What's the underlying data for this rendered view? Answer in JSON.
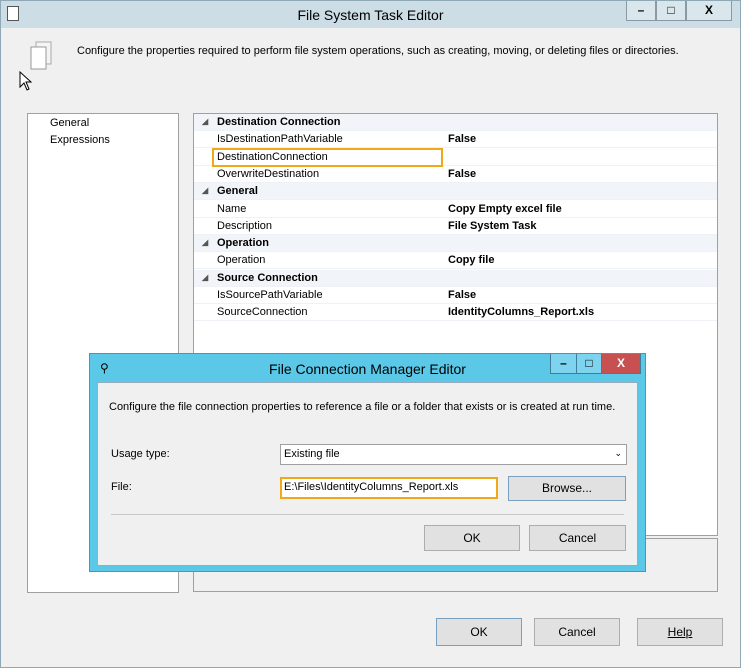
{
  "main": {
    "title": "File System Task Editor",
    "description": "Configure the properties required to perform file system operations, such as creating, moving, or deleting files or directories.",
    "window_buttons": {
      "minimize": "–",
      "maximize": "□",
      "close": "X"
    },
    "nav": [
      "General",
      "Expressions"
    ],
    "groups": [
      {
        "name": "Destination Connection",
        "props": [
          {
            "n": "IsDestinationPathVariable",
            "v": "False"
          },
          {
            "n": "DestinationConnection",
            "v": ""
          },
          {
            "n": "OverwriteDestination",
            "v": "False"
          }
        ]
      },
      {
        "name": "General",
        "props": [
          {
            "n": "Name",
            "v": "Copy Empty excel file"
          },
          {
            "n": "Description",
            "v": "File System Task"
          }
        ]
      },
      {
        "name": "Operation",
        "props": [
          {
            "n": "Operation",
            "v": "Copy file"
          }
        ]
      },
      {
        "name": "Source Connection",
        "props": [
          {
            "n": "IsSourcePathVariable",
            "v": "False"
          },
          {
            "n": "SourceConnection",
            "v": "IdentityColumns_Report.xls"
          }
        ]
      }
    ],
    "ok": "OK",
    "cancel": "Cancel",
    "help": "Help"
  },
  "dialog": {
    "title": "File Connection Manager Editor",
    "description": "Configure the file connection properties to reference a file or a folder that exists or is created at run time.",
    "usage_label": "Usage type:",
    "usage_value": "Existing file",
    "file_label": "File:",
    "file_value": "E:\\Files\\IdentityColumns_Report.xls",
    "browse": "Browse...",
    "ok": "OK",
    "cancel": "Cancel",
    "window_buttons": {
      "minimize": "–",
      "maximize": "□",
      "close": "X"
    }
  }
}
